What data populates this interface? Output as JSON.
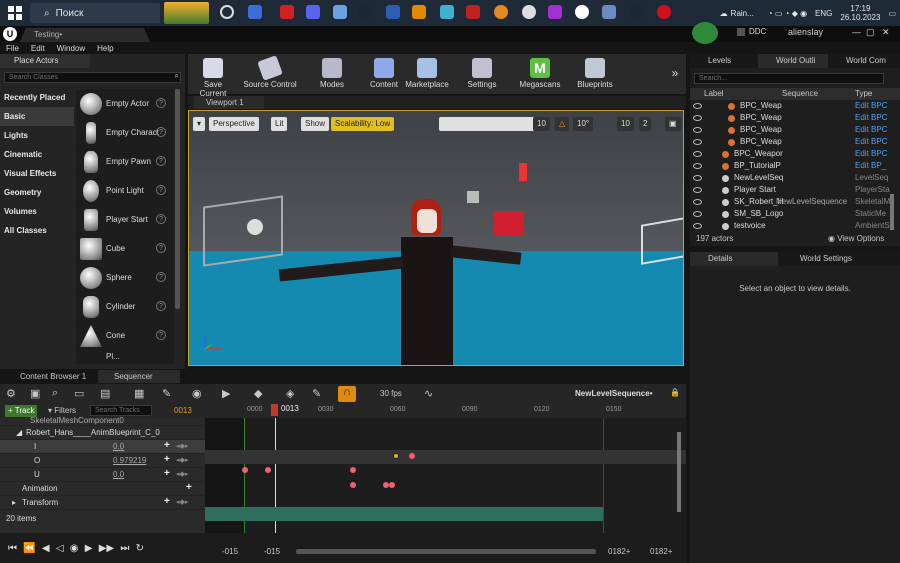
{
  "taskbar": {
    "search_label": "Поиск",
    "weather": "Rain...",
    "lang": "ENG",
    "time": "17:19",
    "date": "26.10.2023"
  },
  "titlebar": {
    "doc_tab": "Testing•",
    "ddc": "DDC",
    "user": "alienslay"
  },
  "menu": [
    "File",
    "Edit",
    "Window",
    "Help"
  ],
  "place_actors": {
    "tab": "Place Actors",
    "search_placeholder": "Search Classes",
    "categories": [
      "Recently Placed",
      "Basic",
      "Lights",
      "Cinematic",
      "Visual Effects",
      "Geometry",
      "Volumes",
      "All Classes"
    ],
    "selected_category": "Basic",
    "items": [
      "Empty Actor",
      "Empty Charact",
      "Empty Pawn",
      "Point Light",
      "Player Start",
      "Cube",
      "Sphere",
      "Cylinder",
      "Cone",
      "Pl..."
    ]
  },
  "toolbar": {
    "save": "Save Current",
    "source": "Source Control",
    "modes": "Modes",
    "content": "Content",
    "marketplace": "Marketplace",
    "settings": "Settings",
    "megascans": "Megascans",
    "blueprints": "Blueprints"
  },
  "viewport": {
    "tab": "Viewport 1",
    "perspective": "Perspective",
    "lit": "Lit",
    "show": "Show",
    "scalability": "Scalability: Low",
    "grid": "10",
    "angle": "10°",
    "scale": "10",
    "cam": "2"
  },
  "outliner": {
    "tabs": [
      "Levels",
      "World Outli",
      "World Com"
    ],
    "search_placeholder": "Search...",
    "headers": [
      "Label",
      "Sequence",
      "Type"
    ],
    "rows": [
      {
        "label": "BPC_Weap",
        "seq": "",
        "type": "Edit BPC"
      },
      {
        "label": "BPC_Weap",
        "seq": "",
        "type": "Edit BPC"
      },
      {
        "label": "BPC_Weap",
        "seq": "",
        "type": "Edit BPC"
      },
      {
        "label": "BPC_Weap",
        "seq": "",
        "type": "Edit BPC"
      },
      {
        "label": "BPC_Weapor",
        "seq": "",
        "type": "Edit BPC"
      },
      {
        "label": "BP_TutorialP",
        "seq": "",
        "type": "Edit BP_"
      },
      {
        "label": "NewLevelSeq",
        "seq": "",
        "type": "LevelSeq"
      },
      {
        "label": "Player Start",
        "seq": "",
        "type": "PlayerSta"
      },
      {
        "label": "SK_Robert_H",
        "seq": "NewLevelSequence",
        "type": "SkeletalM"
      },
      {
        "label": "SM_SB_Logo",
        "seq": "",
        "type": "StaticMe"
      },
      {
        "label": "testvoice",
        "seq": "",
        "type": "AmbientS"
      }
    ],
    "count": "197 actors",
    "view_options": "View Options"
  },
  "details": {
    "tabs": [
      "Details",
      "World Settings"
    ],
    "empty_text": "Select an object to view details."
  },
  "bottom_tabs": [
    "Content Browser 1",
    "Sequencer"
  ],
  "sequencer": {
    "fps": "30 fps",
    "sequence_name": "NewLevelSequence•",
    "track_btn": "+ Track",
    "filters": "Filters",
    "search_placeholder": "Search Tracks",
    "current_frame": "0013",
    "playhead": "0013",
    "ruler": [
      "0000",
      "0030",
      "0060",
      "0090",
      "0120",
      "0150"
    ],
    "tracks": [
      {
        "name": "SkeletalMeshComponent0",
        "value": ""
      },
      {
        "name": "Robert_Hans____AnimBlueprint_C_0",
        "value": ""
      },
      {
        "name": "I",
        "value": "0.0"
      },
      {
        "name": "O",
        "value": "0.979219"
      },
      {
        "name": "U",
        "value": "0.0"
      },
      {
        "name": "Animation",
        "value": ""
      },
      {
        "name": "Transform",
        "value": ""
      }
    ],
    "item_count": "20 items",
    "range_start_a": "-015",
    "range_start_b": "-015",
    "range_end_a": "0182+",
    "range_end_b": "0182+"
  }
}
